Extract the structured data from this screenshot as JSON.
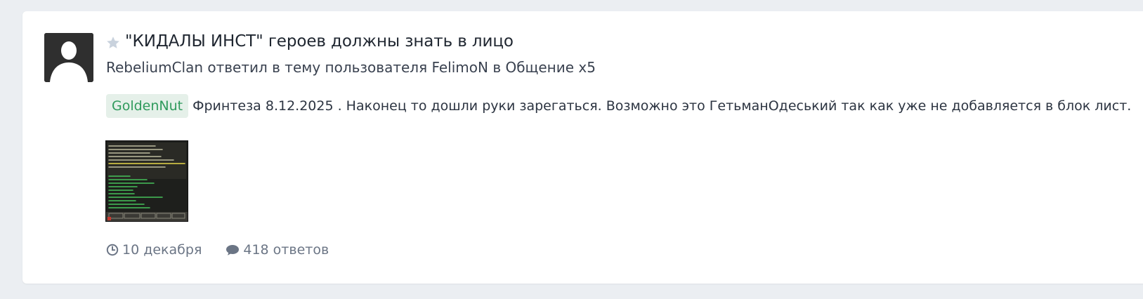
{
  "topic": {
    "title": "\"КИДАЛЫ ИНСТ\" героев должны знать в лицо",
    "meta": "RebeliumClan ответил в тему пользователя FelimoN в Общение x5",
    "tag": "GoldenNut",
    "excerpt": "Фринтеза 8.12.2025 . Наконец то дошли руки зарегаться. Возможно это ГетьманОдеський так как уже не добавляется в блок лист.",
    "date": "10 декабря",
    "replies": "418 ответов"
  },
  "icons": {
    "avatar": "default-user-avatar",
    "star": "star-icon",
    "date": "clock-icon",
    "replies": "comment-icon"
  },
  "colors": {
    "tag_bg": "#e5f0e9",
    "tag_text": "#2f9a5c",
    "meta_footer": "#6b7585",
    "star": "#c9d2dd"
  }
}
